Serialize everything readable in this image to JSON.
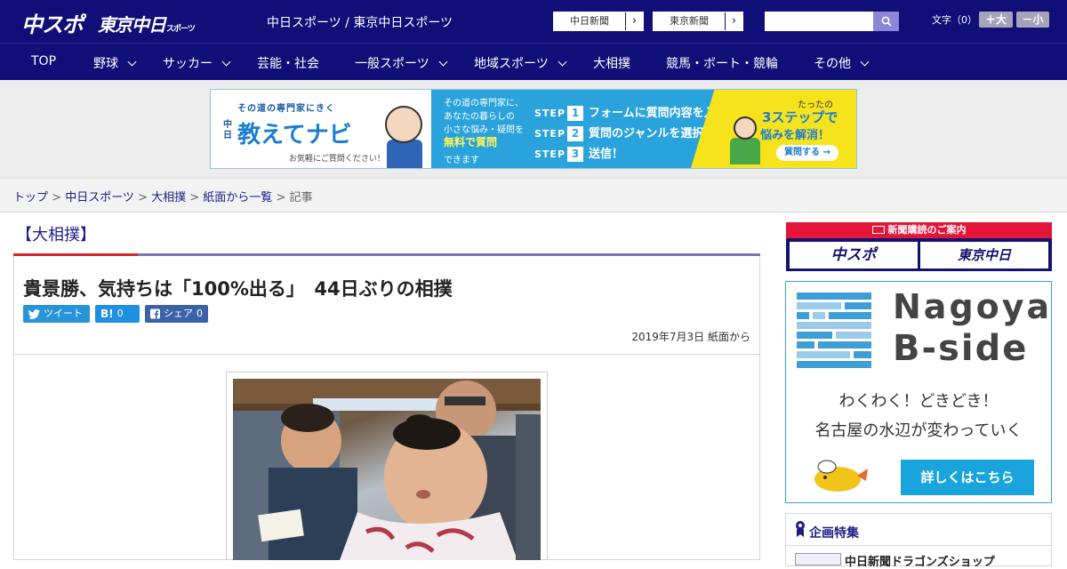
{
  "header": {
    "logo_chuspo": "中スポ",
    "logo_tokyo": "東京中日",
    "logo_tokyo_sub": "スポーツ",
    "site_link": "中日スポーツ / 東京中日スポーツ",
    "paper_links": [
      "中日新聞",
      "東京新聞"
    ],
    "search_placeholder": "",
    "font_size_label": "文字（0）",
    "font_up_label": "＋大",
    "font_down_label": "－小"
  },
  "nav": {
    "items": [
      {
        "label": "TOP",
        "has_menu": false
      },
      {
        "label": "野球",
        "has_menu": true
      },
      {
        "label": "サッカー",
        "has_menu": true
      },
      {
        "label": "芸能・社会",
        "has_menu": false
      },
      {
        "label": "一般スポーツ",
        "has_menu": true
      },
      {
        "label": "地域スポーツ",
        "has_menu": true
      },
      {
        "label": "大相撲",
        "has_menu": false
      },
      {
        "label": "競馬・ボート・競輪",
        "has_menu": false
      },
      {
        "label": "その他",
        "has_menu": true
      }
    ]
  },
  "ad": {
    "tagline": "その道の専門家にきく",
    "brand_prefix": "中日",
    "brand": "教えてナビ",
    "note": "お気軽にご質問ください！",
    "desc_lines": [
      "その道の専門家に、",
      "あなたの暮らしの",
      "小さな悩み・疑問を"
    ],
    "free": "無料で質問",
    "free_tail": "できます",
    "step_label": "STEP",
    "steps": [
      {
        "num": "1",
        "text": "フォームに質問内容を入力"
      },
      {
        "num": "2",
        "text": "質問のジャンルを選択"
      },
      {
        "num": "3",
        "text": "送信！"
      }
    ],
    "right_lead": "たったの",
    "right_headline": "3ステップで",
    "right_sub": "悩みを解消！",
    "cta": "質問する →"
  },
  "breadcrumb": {
    "links": [
      "トップ",
      "中日スポーツ",
      "大相撲",
      "紙面から一覧"
    ],
    "current": "記事",
    "separator": " > "
  },
  "article": {
    "category": "【大相撲】",
    "headline": "貴景勝、気持ちは「100%出る」　44日ぶりの相撲",
    "share": {
      "tweet_label": "ツイート",
      "hatena_label": "B!",
      "hatena_count": "0",
      "fb_label": "シェア",
      "fb_count": "0"
    },
    "dateline": "2019年7月3日 紙面から"
  },
  "sidebar": {
    "subscribe_head": "新聞購読のご案内",
    "subscribe_logos": [
      "中スポ",
      "東京中日"
    ],
    "bside_title1": "Nagoya",
    "bside_title2": "B-side",
    "bside_copy1": "わくわく！どきどき！",
    "bside_copy2": "名古屋の水辺が変わっていく",
    "bside_button": "詳しくはこちら",
    "feature_title": "企画特集",
    "feature_item": "中日新聞ドラゴンズショップ"
  },
  "colors": {
    "header_bg": "#100f77",
    "accent_red": "#d8262a",
    "accent_blue": "#1aa4de",
    "link": "#1c1c8a"
  }
}
